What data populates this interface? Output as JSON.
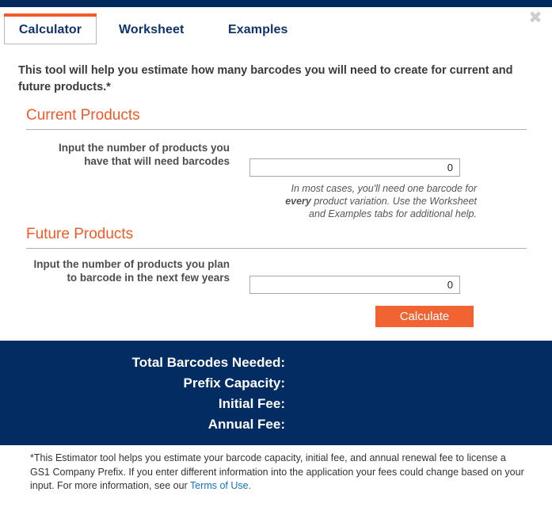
{
  "window": {
    "close_icon": "close-icon",
    "close_glyph": "✖"
  },
  "colors": {
    "navy": "#032C62",
    "navy_strip": "#002B5C",
    "orange": "#F15A29",
    "button_orange": "#F26334",
    "tab_text_navy": "#10336B",
    "link_blue": "#1176BC"
  },
  "tabs": [
    {
      "label": "Calculator",
      "active": true
    },
    {
      "label": "Worksheet",
      "active": false
    },
    {
      "label": "Examples",
      "active": false
    }
  ],
  "intro": "This tool will help you estimate how many barcodes you will need to create for current and future products.*",
  "sections": {
    "current": {
      "heading": "Current Products",
      "label": "Input the number of products you have that will need barcodes",
      "input_value": "0",
      "input_placeholder": "0",
      "help_prefix": "In most cases, you'll need one barcode for ",
      "help_bold": "every",
      "help_suffix": " product variation. Use the Worksheet and Examples tabs for additional help."
    },
    "future": {
      "heading": "Future Products",
      "label": "Input the number of products you plan to barcode in the next few years",
      "input_value": "0",
      "input_placeholder": "0"
    }
  },
  "calculate_button": "Calculate",
  "results": [
    {
      "label": "Total Barcodes Needed:",
      "value": ""
    },
    {
      "label": "Prefix Capacity:",
      "value": ""
    },
    {
      "label": "Initial Fee:",
      "value": ""
    },
    {
      "label": "Annual Fee:",
      "value": ""
    }
  ],
  "footer": {
    "text": "*This Estimator tool helps you estimate your barcode capacity, initial fee, and annual renewal fee to license a GS1 Company Prefix. If you enter different information into the application your fees could change based on your input. For more information, see our ",
    "link_text": "Terms of Use."
  }
}
